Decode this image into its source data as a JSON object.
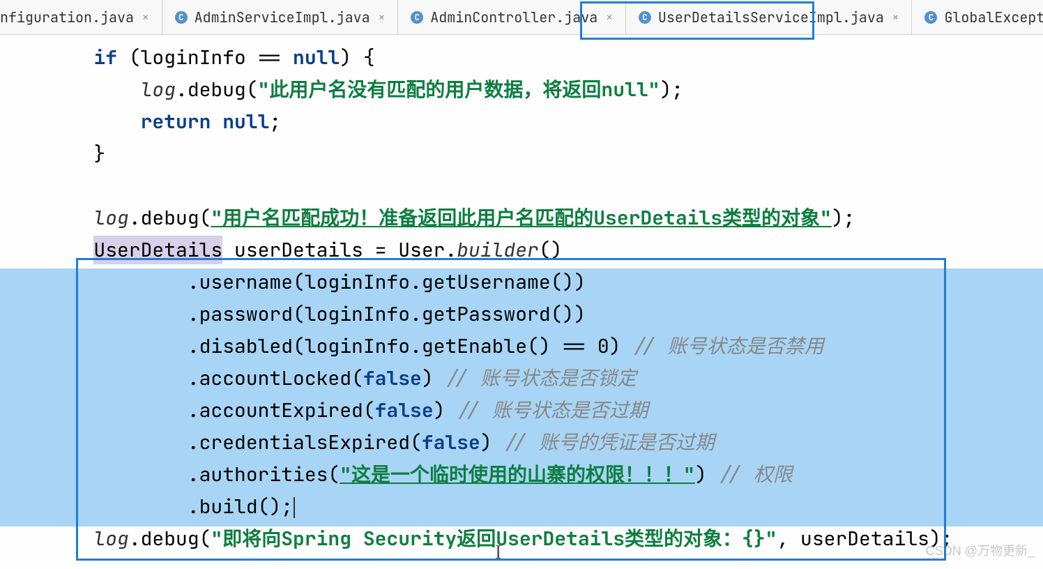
{
  "tabs": [
    {
      "label": "nfiguration.java",
      "hasIcon": false,
      "partial": true
    },
    {
      "label": "AdminServiceImpl.java",
      "hasIcon": true,
      "partial": false
    },
    {
      "label": "AdminController.java",
      "hasIcon": true,
      "partial": false
    },
    {
      "label": "UserDetailsServiceImpl.java",
      "hasIcon": true,
      "partial": false,
      "selected": true
    },
    {
      "label": "GlobalExceptionHandler.jav",
      "hasIcon": true,
      "partial": false
    }
  ],
  "code": {
    "line1_if": "if",
    "line1_rest": " (loginInfo == ",
    "line1_null": "null",
    "line1_end": ") {",
    "line2_log": "log",
    "line2_debug": ".debug(",
    "line2_str": "\"此用户名没有匹配的用户数据，将返回null\"",
    "line2_end": ");",
    "line3_return": "return null",
    "line3_end": ";",
    "line4_brace": "}",
    "line5_log": "log",
    "line5_debug": ".debug(",
    "line5_str": "\"用户名匹配成功！准备返回此用户名匹配的UserDetails类型的对象\"",
    "line5_end": ");",
    "line6_type": "UserDetails",
    "line6_var": " userDetails = User.",
    "line6_builder": "builder",
    "line6_end": "()",
    "line7": ".username(loginInfo.getUsername())",
    "line8": ".password(loginInfo.getPassword())",
    "line9_pre": ".disabled(loginInfo.getEnable() == 0) ",
    "line9_comment": "// 账号状态是否禁用",
    "line10_pre": ".accountLocked(",
    "line10_false": "false",
    "line10_post": ") ",
    "line10_comment": "// 账号状态是否锁定",
    "line11_pre": ".accountExpired(",
    "line11_false": "false",
    "line11_post": ") ",
    "line11_comment": "// 账号状态是否过期",
    "line12_pre": ".credentialsExpired(",
    "line12_false": "false",
    "line12_post": ") ",
    "line12_comment": "// 账号的凭证是否过期",
    "line13_pre": ".authorities(",
    "line13_str": "\"这是一个临时使用的山寨的权限！！！\"",
    "line13_post": ") ",
    "line13_comment": "// 权限",
    "line14": ".build();",
    "line15_log": "log",
    "line15_debug": ".debug(",
    "line15_str": "\"即将向Spring Security返回UserDetails类型的对象：{}\"",
    "line15_mid": ", userDetails);",
    "icon_c": "C"
  },
  "watermark": "CSDN @万物更新_"
}
